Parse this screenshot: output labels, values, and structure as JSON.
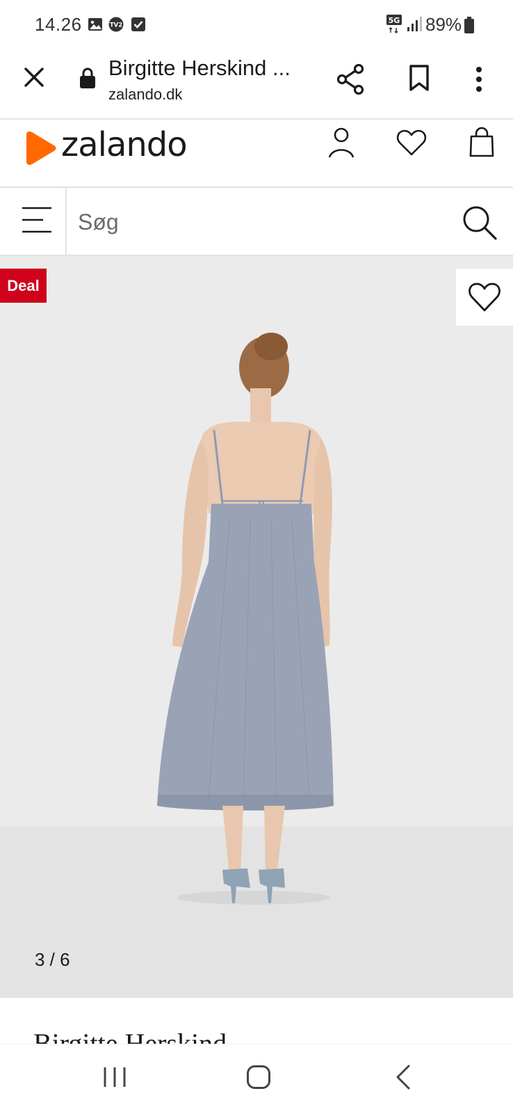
{
  "status_bar": {
    "time": "14.26",
    "network": "5G",
    "battery": "89%"
  },
  "browser": {
    "page_title": "Birgitte Herskind ...",
    "domain": "zalando.dk",
    "icons": [
      "close-icon",
      "lock-icon",
      "share-icon",
      "bookmark-icon",
      "more-vert-icon"
    ]
  },
  "site_header": {
    "brand": "zalando",
    "brand_color": "#ff6900",
    "icons": [
      "account-icon",
      "heart-icon",
      "bag-icon"
    ]
  },
  "search": {
    "placeholder": "Søg"
  },
  "product": {
    "deal_label": "Deal",
    "deal_color": "#d0021b",
    "image_counter": "3 / 6",
    "brand_partial": "Birgitte Herskind"
  },
  "nav": {
    "icons": [
      "recent-apps-icon",
      "home-icon",
      "back-icon"
    ]
  }
}
